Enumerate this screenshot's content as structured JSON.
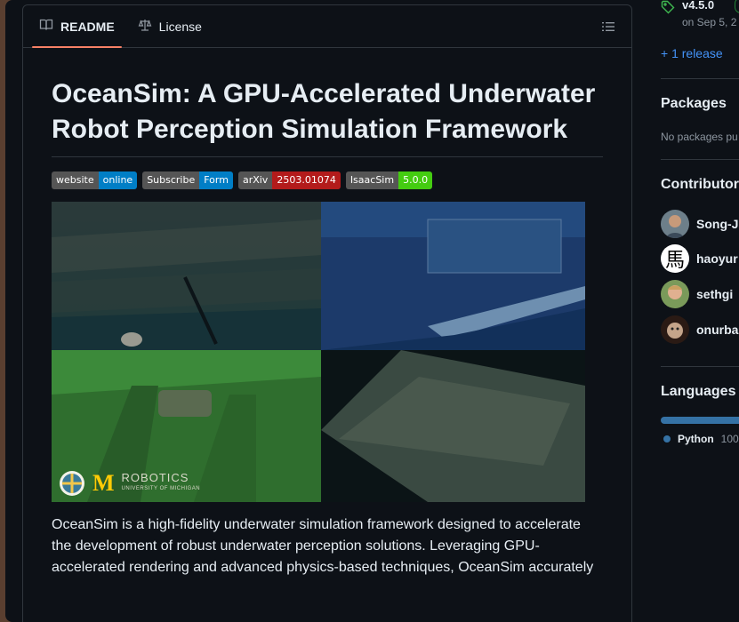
{
  "readme": {
    "tabs": [
      {
        "label": "README",
        "icon": "book-icon",
        "active": true
      },
      {
        "label": "License",
        "icon": "scale-icon",
        "active": false
      }
    ],
    "title": "OceanSim: A GPU-Accelerated Underwater Robot Perception Simulation Framework",
    "badges": [
      {
        "left": "website",
        "right": "online",
        "color": "#007ec6"
      },
      {
        "left": "Subscribe",
        "right": "Form",
        "color": "#007ec6"
      },
      {
        "left": "arXiv",
        "right": "2503.01074",
        "color": "#b31b1b"
      },
      {
        "left": "IsaacSim",
        "right": "5.0.0",
        "color": "#4c1"
      }
    ],
    "hero": {
      "logo_text": "ROBOTICS",
      "logo_subtext": "UNIVERSITY OF MICHIGAN",
      "logo_letter": "M"
    },
    "description": "OceanSim is a high-fidelity underwater simulation framework designed to accelerate the development of robust underwater perception solutions. Leveraging GPU-accelerated rendering and advanced physics-based techniques, OceanSim accurately"
  },
  "sidebar": {
    "release_version": "v4.5.0",
    "release_date": "on Sep 5, 2",
    "more_releases": "+ 1 release",
    "packages_title": "Packages",
    "packages_empty": "No packages pu",
    "contributors_title": "Contributor",
    "contributors": [
      {
        "name": "Song-J"
      },
      {
        "name": "haoyur",
        "avatar_glyph": "馬"
      },
      {
        "name": "sethgi"
      },
      {
        "name": "onurba"
      }
    ],
    "languages_title": "Languages",
    "languages": [
      {
        "name": "Python",
        "percent": "100",
        "color": "#3572a5"
      }
    ]
  },
  "colors": {
    "accent_tab": "#f78166",
    "link": "#4493f8",
    "background": "#0d1117"
  }
}
